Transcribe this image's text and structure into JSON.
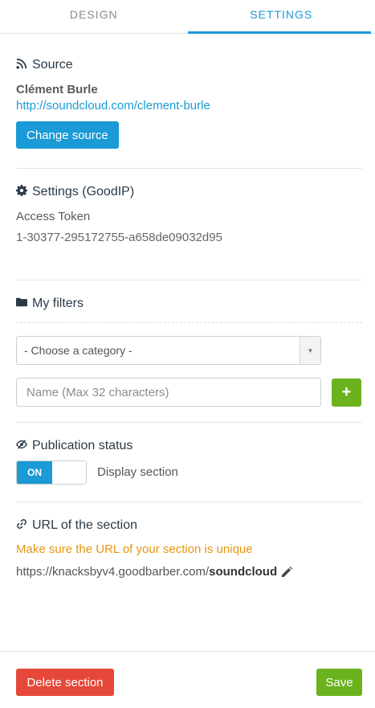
{
  "tabs": [
    {
      "label": "DESIGN",
      "active": false
    },
    {
      "label": "SETTINGS",
      "active": true
    }
  ],
  "source": {
    "title": "Source",
    "name": "Clément Burle",
    "url": "http://soundcloud.com/clement-burle",
    "change_button": "Change source"
  },
  "settings": {
    "title": "Settings (GoodIP)",
    "token_label": "Access Token",
    "token_value": "1-30377-295172755-a658de09032d95"
  },
  "filters": {
    "title": "My filters",
    "category_select": "- Choose a category -",
    "name_placeholder": "Name (Max 32 characters)",
    "add_button": "+"
  },
  "publication": {
    "title": "Publication status",
    "toggle_on": "ON",
    "display_label": "Display section"
  },
  "url_section": {
    "title": "URL of the section",
    "warning": "Make sure the URL of your section is unique",
    "base_url": "https://knacksbyv4.goodbarber.com/",
    "slug": "soundcloud"
  },
  "footer": {
    "delete_button": "Delete section",
    "save_button": "Save"
  },
  "colors": {
    "accent": "#1a9ad6",
    "danger": "#e5483a",
    "success": "#6bb31d",
    "warning": "#e8950e"
  },
  "icons": {
    "source": "rss-icon",
    "settings": "gear-icon",
    "filters": "folder-icon",
    "publication": "eye-slash-icon",
    "url": "link-icon",
    "edit": "pencil-icon"
  }
}
